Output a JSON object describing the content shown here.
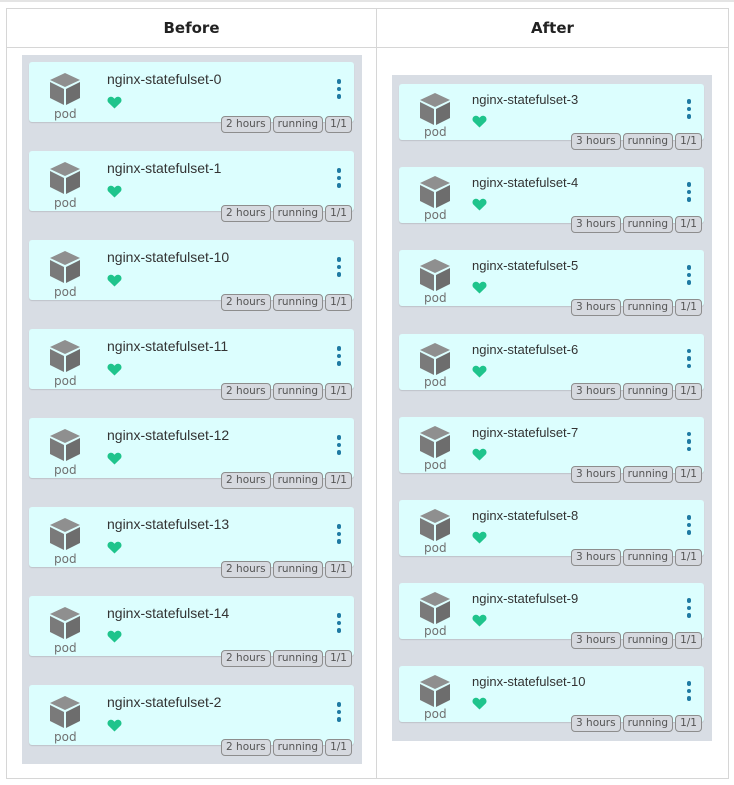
{
  "headers": {
    "before": "Before",
    "after": "After"
  },
  "icons": {
    "pod": "cube-icon",
    "health": "heart-icon",
    "menu": "kebab-menu-icon"
  },
  "colors": {
    "card_bg": "#dcfefe",
    "heart": "#1fc48c",
    "menu": "#1f7aa3",
    "panel_bg": "#d8dde4"
  },
  "before": {
    "pods": [
      {
        "name": "nginx-statefulset-0",
        "type": "pod",
        "age": "2 hours",
        "status": "running",
        "ready": "1/1"
      },
      {
        "name": "nginx-statefulset-1",
        "type": "pod",
        "age": "2 hours",
        "status": "running",
        "ready": "1/1"
      },
      {
        "name": "nginx-statefulset-10",
        "type": "pod",
        "age": "2 hours",
        "status": "running",
        "ready": "1/1"
      },
      {
        "name": "nginx-statefulset-11",
        "type": "pod",
        "age": "2 hours",
        "status": "running",
        "ready": "1/1"
      },
      {
        "name": "nginx-statefulset-12",
        "type": "pod",
        "age": "2 hours",
        "status": "running",
        "ready": "1/1"
      },
      {
        "name": "nginx-statefulset-13",
        "type": "pod",
        "age": "2 hours",
        "status": "running",
        "ready": "1/1"
      },
      {
        "name": "nginx-statefulset-14",
        "type": "pod",
        "age": "2 hours",
        "status": "running",
        "ready": "1/1"
      },
      {
        "name": "nginx-statefulset-2",
        "type": "pod",
        "age": "2 hours",
        "status": "running",
        "ready": "1/1"
      }
    ]
  },
  "after": {
    "pods": [
      {
        "name": "nginx-statefulset-3",
        "type": "pod",
        "age": "3 hours",
        "status": "running",
        "ready": "1/1"
      },
      {
        "name": "nginx-statefulset-4",
        "type": "pod",
        "age": "3 hours",
        "status": "running",
        "ready": "1/1"
      },
      {
        "name": "nginx-statefulset-5",
        "type": "pod",
        "age": "3 hours",
        "status": "running",
        "ready": "1/1"
      },
      {
        "name": "nginx-statefulset-6",
        "type": "pod",
        "age": "3 hours",
        "status": "running",
        "ready": "1/1"
      },
      {
        "name": "nginx-statefulset-7",
        "type": "pod",
        "age": "3 hours",
        "status": "running",
        "ready": "1/1"
      },
      {
        "name": "nginx-statefulset-8",
        "type": "pod",
        "age": "3 hours",
        "status": "running",
        "ready": "1/1"
      },
      {
        "name": "nginx-statefulset-9",
        "type": "pod",
        "age": "3 hours",
        "status": "running",
        "ready": "1/1"
      },
      {
        "name": "nginx-statefulset-10",
        "type": "pod",
        "age": "3 hours",
        "status": "running",
        "ready": "1/1"
      }
    ]
  }
}
